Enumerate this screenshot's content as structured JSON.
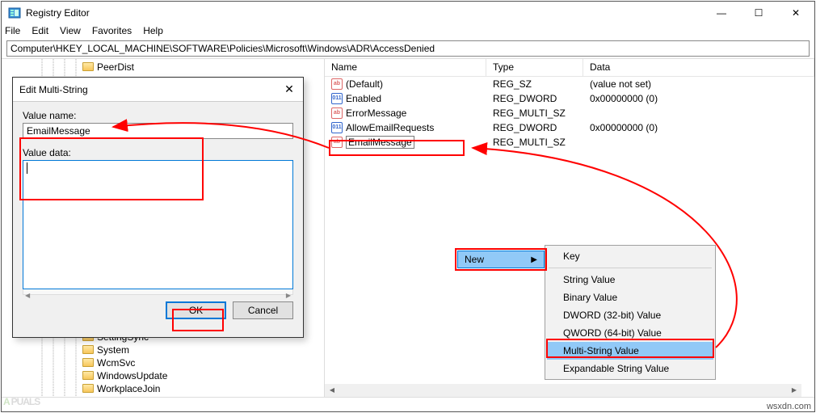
{
  "window": {
    "title": "Registry Editor",
    "buttons": {
      "min": "—",
      "max": "☐",
      "close": "✕"
    }
  },
  "menu": {
    "file": "File",
    "edit": "Edit",
    "view": "View",
    "favorites": "Favorites",
    "help": "Help"
  },
  "address": "Computer\\HKEY_LOCAL_MACHINE\\SOFTWARE\\Policies\\Microsoft\\Windows\\ADR\\AccessDenied",
  "tree": {
    "items": [
      {
        "label": "PeerDist"
      },
      {
        "label": "SettingSync"
      },
      {
        "label": "System"
      },
      {
        "label": "WcmSvc"
      },
      {
        "label": "WindowsUpdate"
      },
      {
        "label": "WorkplaceJoin"
      }
    ]
  },
  "list": {
    "headers": {
      "name": "Name",
      "type": "Type",
      "data": "Data"
    },
    "rows": [
      {
        "icon": "sz",
        "name": "(Default)",
        "type": "REG_SZ",
        "data": "(value not set)"
      },
      {
        "icon": "dw",
        "name": "Enabled",
        "type": "REG_DWORD",
        "data": "0x00000000 (0)"
      },
      {
        "icon": "sz",
        "name": "ErrorMessage",
        "type": "REG_MULTI_SZ",
        "data": ""
      },
      {
        "icon": "dw",
        "name": "AllowEmailRequests",
        "type": "REG_DWORD",
        "data": "0x00000000 (0)"
      },
      {
        "icon": "sz",
        "name": "EmailMessage",
        "type": "REG_MULTI_SZ",
        "data": "",
        "editing": true
      }
    ]
  },
  "dialog": {
    "title": "Edit Multi-String",
    "value_name_label": "Value name:",
    "value_name": "EmailMessage",
    "value_data_label": "Value data:",
    "value_data": "",
    "ok": "OK",
    "cancel": "Cancel"
  },
  "submenu": {
    "new": "New"
  },
  "context_menu": {
    "items": [
      "Key",
      "String Value",
      "Binary Value",
      "DWORD (32-bit) Value",
      "QWORD (64-bit) Value",
      "Multi-String Value",
      "Expandable String Value"
    ]
  },
  "credit": "wsxdn.com",
  "watermark": "A?PUALS"
}
